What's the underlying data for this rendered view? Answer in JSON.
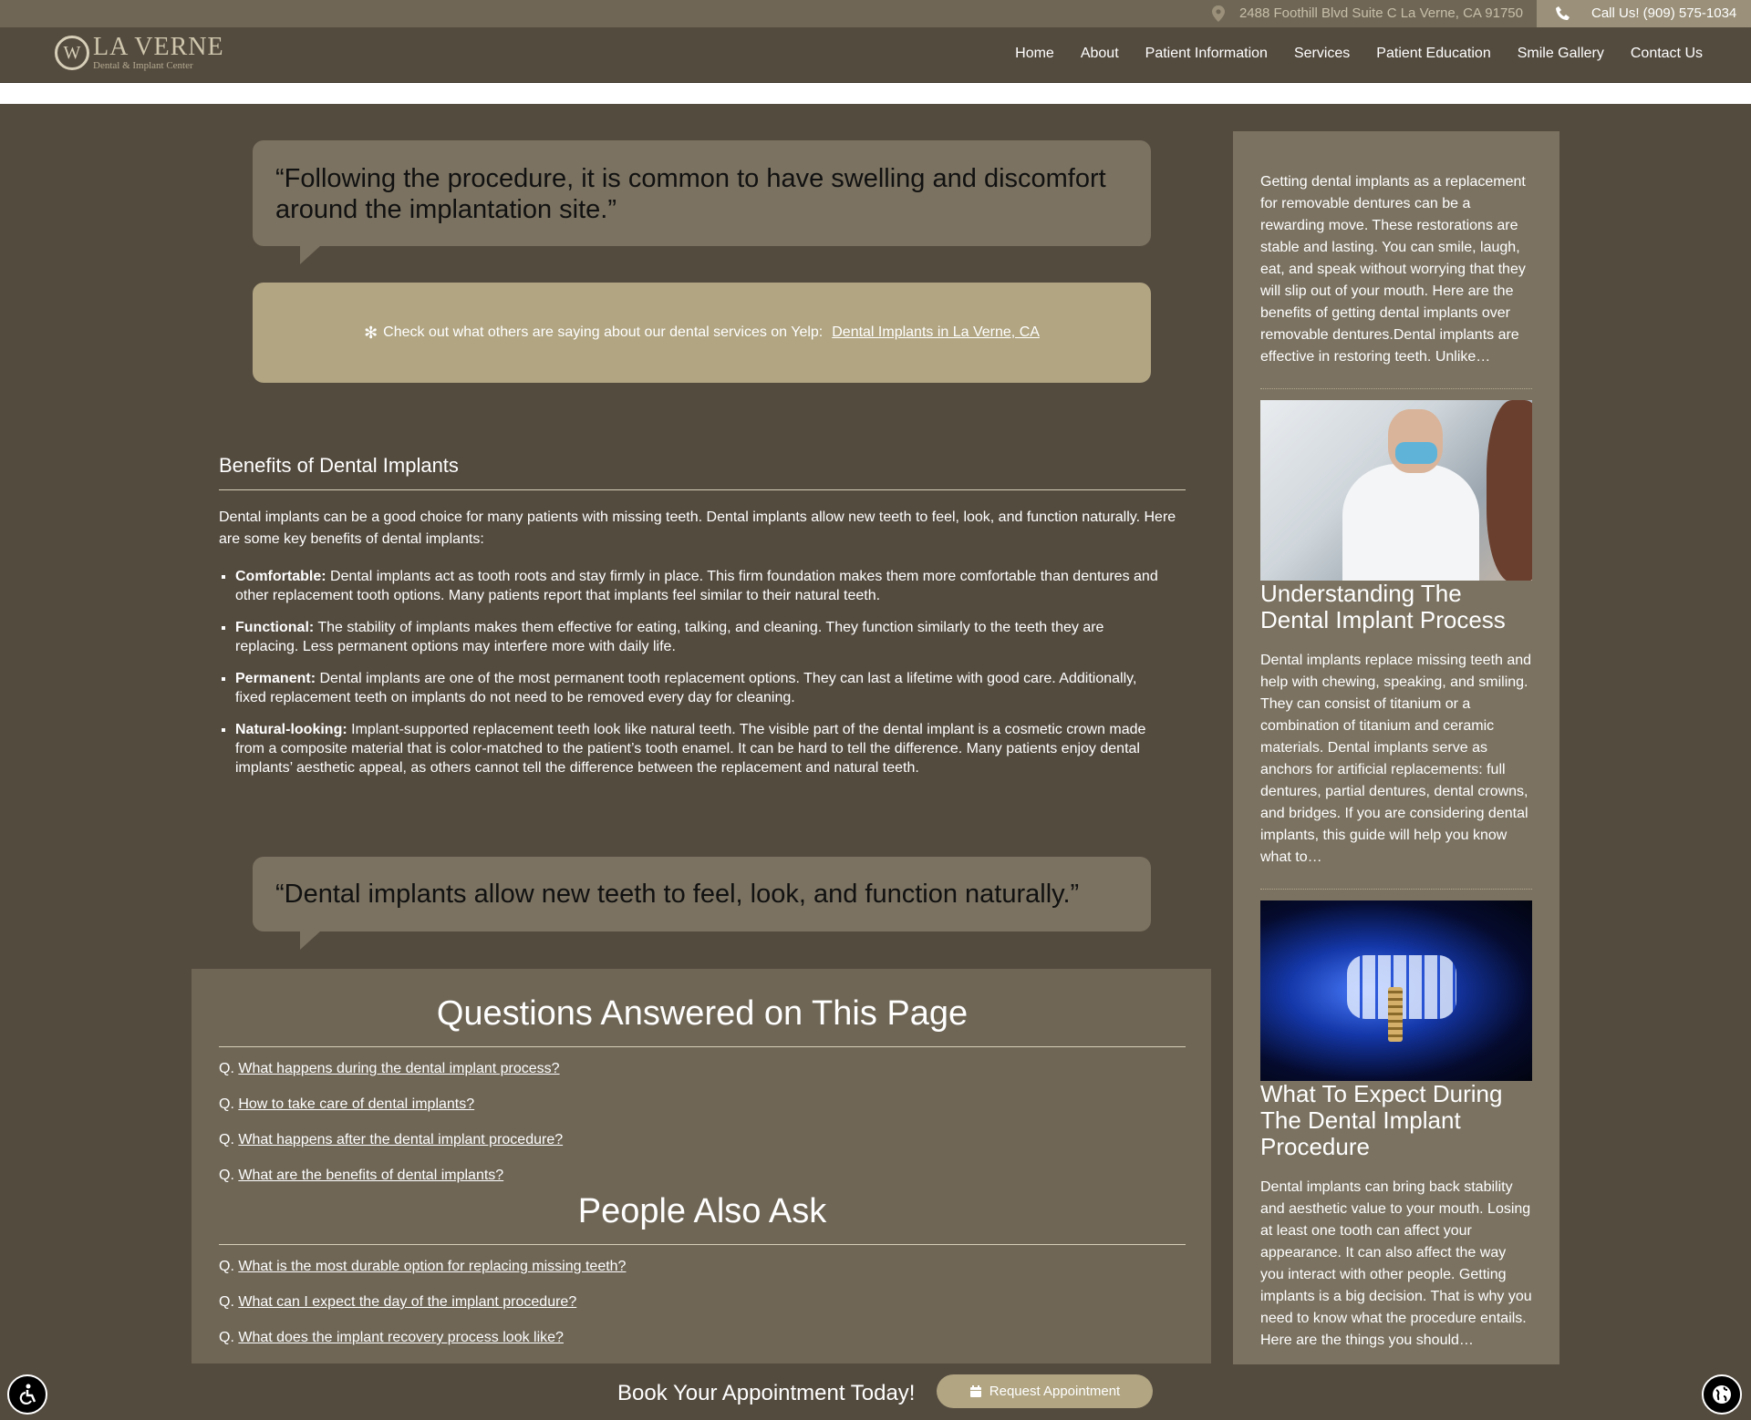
{
  "topbar": {
    "address": "2488 Foothill Blvd Suite C La Verne, CA 91750",
    "call": "Call Us! (909) 575-1034"
  },
  "logo": {
    "name": "LA VERNE",
    "tagline": "Dental & Implant Center"
  },
  "nav": [
    "Home",
    "About",
    "Patient Information",
    "Services",
    "Patient Education",
    "Smile Gallery",
    "Contact Us"
  ],
  "quotes": {
    "q1": "“Following the procedure, it is common to have swelling and discomfort around the implantation site.”",
    "q2": "“Dental implants allow new teeth to feel, look, and function naturally.”"
  },
  "yelp": {
    "text": "Check out what others are saying about our dental services on Yelp:",
    "link": "Dental Implants in La Verne, CA"
  },
  "article": {
    "heading": "Benefits of Dental Implants",
    "intro": "Dental implants can be a good choice for many patients with missing teeth. Dental implants allow new teeth to feel, look, and function naturally. Here are some key benefits of dental implants:",
    "items": [
      {
        "term": "Comfortable:",
        "text": " Dental implants act as tooth roots and stay firmly in place. This firm foundation makes them more comfortable than dentures and other replacement tooth options. Many patients report that implants feel similar to their natural teeth."
      },
      {
        "term": "Functional:",
        "text": " The stability of implants makes them effective for eating, talking, and cleaning. They function similarly to the teeth they are replacing. Less permanent options may interfere more with daily life."
      },
      {
        "term": "Permanent:",
        "text": " Dental implants are one of the most permanent tooth replacement options. They can last a lifetime with good care. Additionally, fixed replacement teeth on implants do not need to be removed every day for cleaning."
      },
      {
        "term": "Natural-looking:",
        "text": " Implant-supported replacement teeth look like natural teeth. The visible part of the dental implant is a cosmetic crown made from a composite material that is color-matched to the patient’s tooth enamel. It can be hard to tell the difference. Many patients enjoy dental implants’ aesthetic appeal, as others cannot tell the difference between the replacement and natural teeth."
      }
    ]
  },
  "questions": {
    "heading": "Questions Answered on This Page",
    "prefix": "Q.",
    "items": [
      "What happens during the dental implant process?",
      "How to take care of dental implants?",
      "What happens after the dental implant procedure?",
      "What are the benefits of dental implants?"
    ]
  },
  "people_ask": {
    "heading": "People Also Ask",
    "items": [
      "What is the most durable option for replacing missing teeth?",
      "What can I expect the day of the implant procedure?",
      "What does the implant recovery process look like?"
    ]
  },
  "sidebar": {
    "excerpt1": "Getting dental implants as a replacement for removable dentures can be a rewarding move. These restorations are stable and lasting. You can smile, laugh, eat, and speak without worrying that they will slip out of your mouth. Here are the benefits of getting dental implants over removable dentures.Dental implants are effective in restoring teeth. Unlike…",
    "post2": {
      "title": "Understanding The Dental Implant Process",
      "excerpt": "Dental implants replace missing teeth and help with chewing, speaking, and smiling. They can consist of titanium or a combination of titanium and ceramic materials. Dental implants serve as anchors for artificial replacements: full dentures, partial dentures, dental crowns, and bridges. If you are considering dental implants, this guide will help you know what to…"
    },
    "post3": {
      "title": "What To Expect During The Dental Implant Procedure",
      "excerpt": "Dental implants can bring back stability and aesthetic value to your mouth. Losing at least one tooth can affect your appearance. It can also affect the way you interact with other people. Getting implants is a big decision. That is why you need to know what the procedure entails. Here are the things you should…"
    }
  },
  "bookbar": {
    "text": "Book Your Appointment Today!",
    "button": "Request Appointment"
  },
  "colors": {
    "background": "#544b3f",
    "panel": "#6f6656",
    "quote": "#7b7261",
    "accent": "#b1a582"
  },
  "icons": [
    "map-pin-icon",
    "phone-icon",
    "yelp-icon",
    "calendar-icon",
    "accessibility-icon",
    "globe-icon"
  ]
}
